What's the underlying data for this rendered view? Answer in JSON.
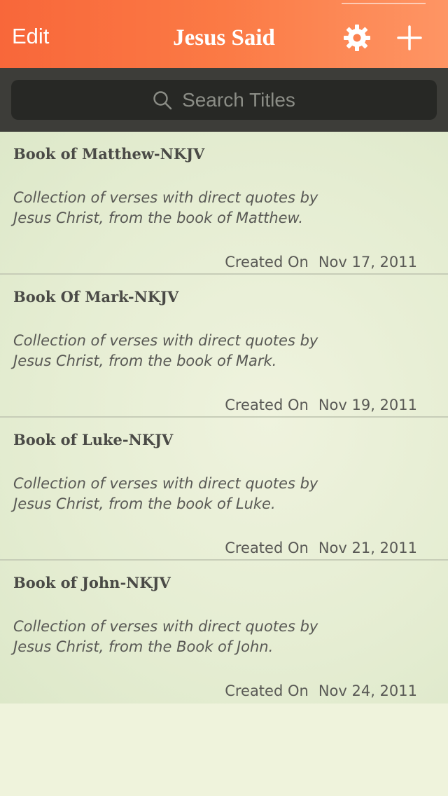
{
  "navbar": {
    "edit_label": "Edit",
    "title": "Jesus Said",
    "settings_icon": "gear-icon",
    "add_icon": "plus-icon",
    "colors": {
      "start": "#f8673a",
      "end": "#fe9564"
    }
  },
  "search": {
    "placeholder": "Search Titles",
    "icon": "search-icon"
  },
  "list": {
    "items": [
      {
        "title": "Book of Matthew-NKJV",
        "description_line1": "Collection of verses with direct quotes by",
        "description_line2": "Jesus Christ, from the book of Matthew.",
        "created_label": "Created On",
        "created_date": "Nov 17, 2011"
      },
      {
        "title": "Book Of Mark-NKJV",
        "description_line1": "Collection of verses with direct quotes by",
        "description_line2": "Jesus Christ, from the book of Mark.",
        "created_label": "Created On",
        "created_date": "Nov 19, 2011"
      },
      {
        "title": "Book of Luke-NKJV",
        "description_line1": "Collection of verses with direct quotes by",
        "description_line2": "Jesus Christ, from the book of Luke.",
        "created_label": "Created On",
        "created_date": "Nov 21, 2011"
      },
      {
        "title": "Book of John-NKJV",
        "description_line1": "Collection of verses with direct quotes by",
        "description_line2": "Jesus Christ, from the Book of John.",
        "created_label": "Created On",
        "created_date": "Nov 24, 2011"
      }
    ]
  }
}
